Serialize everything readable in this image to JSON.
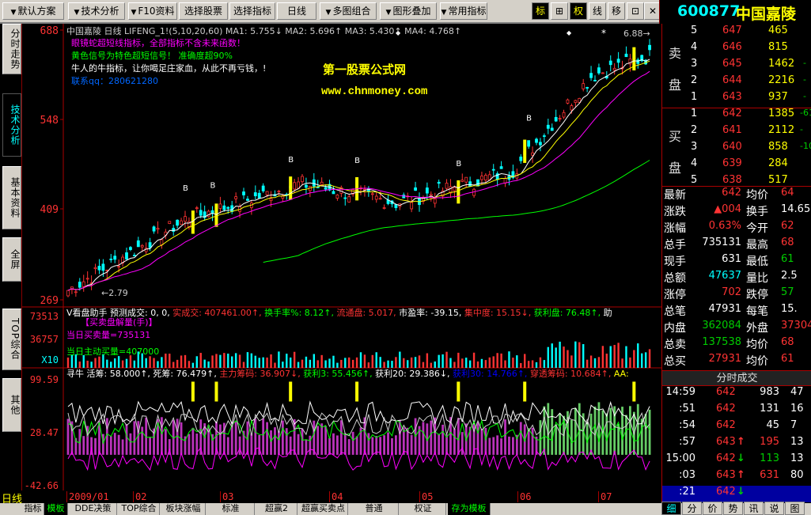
{
  "toolbar": {
    "buttons": [
      {
        "label": "默认方案",
        "arrow": "▼"
      },
      {
        "label": "技术分析",
        "arrow": "▼"
      },
      {
        "label": "F10资料",
        "arrow": "▼"
      },
      {
        "label": "选择股票",
        "arrow": ""
      },
      {
        "label": "选择指标",
        "arrow": ""
      },
      {
        "label": "日线",
        "arrow": ""
      },
      {
        "label": "多图组合",
        "arrow": "▼"
      },
      {
        "label": "图形叠加",
        "arrow": "▼"
      },
      {
        "label": "常用指标",
        "arrow": "▼"
      }
    ],
    "tools": [
      "标",
      "⊞",
      "权",
      "线",
      "移",
      "⊡",
      "✕"
    ]
  },
  "stock": {
    "code": "600877",
    "name": "中国嘉陵"
  },
  "side_tabs": [
    "分时走势",
    "技术分析",
    "基本资料",
    "全屏",
    "TOP综合",
    "其他"
  ],
  "main_chart": {
    "header": "中国嘉陵 日线 LIFENG_1!(5,10,20,60) MA1: 5.755↓ MA2: 5.696↑ MA3: 5.430↑ MA4: 4.768↑",
    "notes": [
      {
        "text": "眼镜蛇超短线指标，全部指标不含未来函数！",
        "color": "#ff00ff"
      },
      {
        "text": "黄色信号为特色超短信号！ 准确度超90%",
        "color": "#00ff00"
      },
      {
        "text": "牛人的牛指标，让你喝足庄家血，从此不再亏钱，!",
        "color": "#ffffff"
      },
      {
        "text": "联系qq：280621280",
        "color": "#0066ff"
      }
    ],
    "watermark": [
      "第一股票公式网",
      "www.chnmoney.com"
    ],
    "high_label": "6.88",
    "low_label": "2.79",
    "y_labels": [
      "688",
      "548",
      "409",
      "269"
    ],
    "signal_label": "B",
    "star": "*",
    "dot": "◆",
    "arrow_mark": "↓",
    "price_min": 2.69,
    "price_max": 6.88
  },
  "vol_panel": {
    "header": [
      {
        "text": "V看盘助手 预测成交: 0, 0, ",
        "color": "#ffffff"
      },
      {
        "text": "实成交: 407461.00↑, ",
        "color": "#ff3333"
      },
      {
        "text": "换手率%: 8.12↑, ",
        "color": "#00ff00"
      },
      {
        "text": "流通盘: 5.017, ",
        "color": "#ff3333"
      },
      {
        "text": "市盈率: -39.15, ",
        "color": "#ffffff"
      },
      {
        "text": "集中度: 15.15↓, ",
        "color": "#ff3333"
      },
      {
        "text": "获利盘: 76.48↑, ",
        "color": "#00ff00"
      },
      {
        "text": "助",
        "color": "#ffffff"
      }
    ],
    "sub1": "【买卖盘解量(手)】",
    "sub2": "当日买卖量=735131",
    "sub3": "当日主动买量=407000",
    "y_labels": [
      "73513",
      "36757",
      "X10"
    ]
  },
  "ind_panel": {
    "header": [
      {
        "text": "寻牛 活筹: 58.000↑, ",
        "color": "#ffffff"
      },
      {
        "text": "死筹: 76.479↑, ",
        "color": "#ffffff"
      },
      {
        "text": "主力筹码: 36.907↓, ",
        "color": "#ff3333"
      },
      {
        "text": "获利3: 55.456↑, ",
        "color": "#00ff00"
      },
      {
        "text": "获利20: 29.386↓, ",
        "color": "#ffffff"
      },
      {
        "text": "获利30: 14.766↑, ",
        "color": "#0000ff"
      },
      {
        "text": "穿透筹码: 10.684↑, ",
        "color": "#ff3333"
      },
      {
        "text": "AA:",
        "color": "#ffff00"
      }
    ],
    "y_labels": [
      "99.59",
      "28.47",
      "-42.66"
    ]
  },
  "date_axis": [
    "2009/01",
    "02",
    "03",
    "04",
    "05",
    "06",
    "07"
  ],
  "period_label": "日线",
  "bottom_tabs": [
    "指标",
    "模板",
    "DDE决策",
    "TOP综合",
    "板块涨幅",
    "标准",
    "超赢2",
    "超赢买卖点",
    "普通",
    "权证",
    "存为模板"
  ],
  "order_book": {
    "sell_label": [
      "卖",
      "盘"
    ],
    "buy_label": [
      "买",
      "盘"
    ],
    "sell": [
      {
        "n": "5",
        "price": "647",
        "vol": "465",
        "chg": ""
      },
      {
        "n": "4",
        "price": "646",
        "vol": "815",
        "chg": ""
      },
      {
        "n": "3",
        "price": "645",
        "vol": "1462",
        "chg": "-"
      },
      {
        "n": "2",
        "price": "644",
        "vol": "2216",
        "chg": "-"
      },
      {
        "n": "1",
        "price": "643",
        "vol": "937",
        "chg": "-"
      }
    ],
    "buy": [
      {
        "n": "1",
        "price": "642",
        "vol": "1385",
        "chg": "-61"
      },
      {
        "n": "2",
        "price": "641",
        "vol": "2112",
        "chg": "-"
      },
      {
        "n": "3",
        "price": "640",
        "vol": "858",
        "chg": "-10"
      },
      {
        "n": "4",
        "price": "639",
        "vol": "284",
        "chg": ""
      },
      {
        "n": "5",
        "price": "638",
        "vol": "517",
        "chg": ""
      }
    ]
  },
  "quote": [
    {
      "l1": "最新",
      "v1": "642",
      "c1": "red",
      "l2": "均价",
      "v2": "64",
      "c2": "red"
    },
    {
      "l1": "涨跌",
      "v1": "▲004",
      "c1": "red",
      "l2": "换手",
      "v2": "14.65",
      "c2": "white"
    },
    {
      "l1": "涨幅",
      "v1": "0.63%",
      "c1": "red",
      "l2": "今开",
      "v2": "62",
      "c2": "red"
    },
    {
      "l1": "总手",
      "v1": "735131",
      "c1": "white",
      "l2": "最高",
      "v2": "68",
      "c2": "red"
    },
    {
      "l1": "现手",
      "v1": "631",
      "c1": "white",
      "l2": "最低",
      "v2": "61",
      "c2": "green"
    },
    {
      "l1": "总额",
      "v1": "47637",
      "c1": "cyan",
      "l2": "量比",
      "v2": "2.5",
      "c2": "white"
    },
    {
      "l1": "涨停",
      "v1": "702",
      "c1": "red",
      "l2": "跌停",
      "v2": "57",
      "c2": "green"
    },
    {
      "l1": "总笔",
      "v1": "47931",
      "c1": "white",
      "l2": "每笔",
      "v2": "15.",
      "c2": "white"
    },
    {
      "l1": "内盘",
      "v1": "362084",
      "c1": "green",
      "l2": "外盘",
      "v2": "37304",
      "c2": "red"
    },
    {
      "l1": "总卖",
      "v1": "137538",
      "c1": "green",
      "l2": "均价",
      "v2": "68",
      "c2": "red"
    },
    {
      "l1": "总买",
      "v1": "27931",
      "c1": "red",
      "l2": "均价",
      "v2": "61",
      "c2": "red"
    }
  ],
  "ticks_header": "分时成交",
  "ticks": [
    {
      "time": "14:59",
      "price": "642",
      "dir": "",
      "vol": "983",
      "n": "47",
      "vcol": "white",
      "sel": false
    },
    {
      "time": ":51",
      "price": "642",
      "dir": "",
      "vol": "131",
      "n": "16",
      "vcol": "white",
      "sel": false
    },
    {
      "time": ":54",
      "price": "642",
      "dir": "",
      "vol": "45",
      "n": "7",
      "vcol": "white",
      "sel": false
    },
    {
      "time": ":57",
      "price": "643",
      "dir": "↑",
      "vol": "195",
      "n": "13",
      "vcol": "red",
      "sel": false
    },
    {
      "time": "15:00",
      "price": "642",
      "dir": "↓",
      "vol": "113",
      "n": "13",
      "vcol": "green",
      "sel": false
    },
    {
      "time": ":03",
      "price": "643",
      "dir": "↑",
      "vol": "631",
      "n": "80",
      "vcol": "red",
      "sel": false
    },
    {
      "time": ":21",
      "price": "642",
      "dir": "↓",
      "vol": "",
      "n": "",
      "vcol": "white",
      "sel": true
    }
  ],
  "right_tabs": [
    "细",
    "分",
    "价",
    "势",
    "讯",
    "说",
    "图"
  ],
  "colors": {
    "up": "#ff3333",
    "down": "#00ffff",
    "ma1": "#ffffff",
    "ma2": "#ffff00",
    "ma3": "#ff00ff",
    "ma4": "#00ff00",
    "axis": "#aa0000"
  }
}
